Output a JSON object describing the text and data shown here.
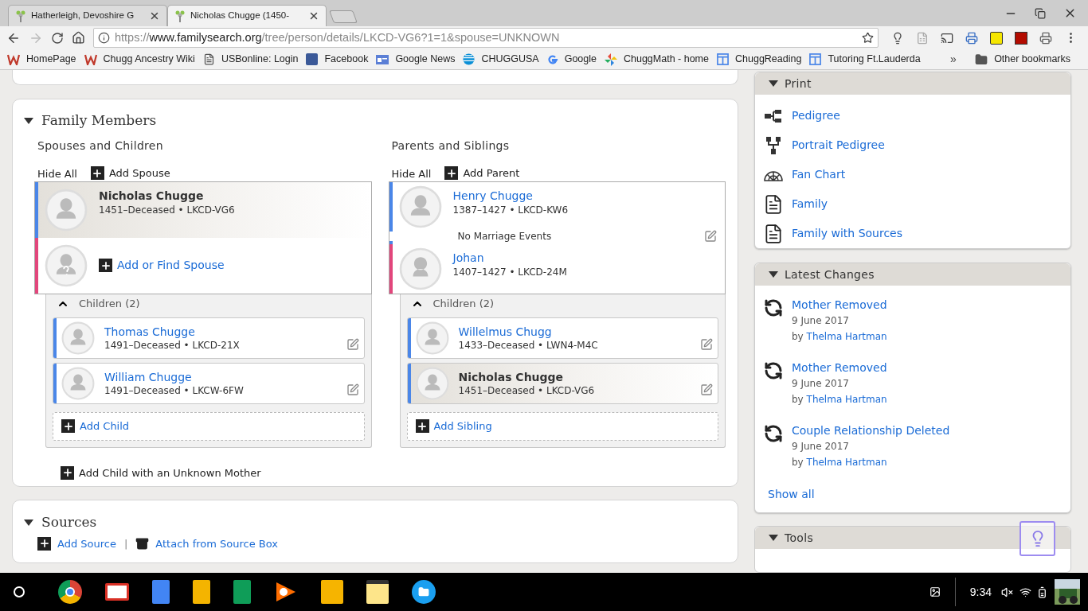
{
  "browser": {
    "tabs": [
      {
        "title": "Hatherleigh, Devoshire G",
        "selected": false
      },
      {
        "title": "Nicholas Chugge (1450-",
        "selected": true
      }
    ],
    "url": {
      "scheme": "https://",
      "domain": "www.familysearch.org",
      "path": "/tree/person/details/LKCD-VG6?1=1&spouse=UNKNOWN"
    },
    "bookmarks": [
      {
        "label": "HomePage",
        "kind": "wiki"
      },
      {
        "label": "Chugg Ancestry Wiki",
        "kind": "wiki"
      },
      {
        "label": "USBonline: Login",
        "kind": "page"
      },
      {
        "label": "Facebook",
        "kind": "facebook"
      },
      {
        "label": "Google News",
        "kind": "news"
      },
      {
        "label": "CHUGGUSA",
        "kind": "globe"
      },
      {
        "label": "Google",
        "kind": "google"
      },
      {
        "label": "ChuggMath - home",
        "kind": "pinwheel"
      },
      {
        "label": "ChuggReading",
        "kind": "sheet"
      },
      {
        "label": "Tutoring Ft.Lauderda",
        "kind": "sheet"
      }
    ],
    "overflow": "»",
    "other_bookmarks": "Other bookmarks"
  },
  "family_members": {
    "title": "Family Members",
    "expanded": true,
    "spouses": {
      "heading": "Spouses and Children",
      "hide_all": "Hide All",
      "add_label": "Add Spouse",
      "couple": [
        {
          "kind": "male",
          "name": "Nicholas Chugge",
          "details": "1451–Deceased • LKCD-VG6",
          "current": true
        },
        {
          "kind": "unknown",
          "add_label": "Add or Find Spouse"
        }
      ],
      "children_label": "Children (2)",
      "children_expanded": true,
      "children": [
        {
          "kind": "male",
          "name": "Thomas Chugge",
          "details": "1491–Deceased • LKCD-21X",
          "current": false
        },
        {
          "kind": "male",
          "name": "William Chugge",
          "details": "1491–Deceased • LKCW-6FW",
          "current": false
        }
      ],
      "add_child": "Add Child"
    },
    "parents": {
      "heading": "Parents and Siblings",
      "hide_all": "Hide All",
      "add_label": "Add Parent",
      "couple": [
        {
          "kind": "male",
          "name": "Henry Chugge",
          "details": "1387–1427 • LKCD-KW6",
          "current": false
        },
        {
          "kind": "female",
          "name": "Johan",
          "details": "1407–1427 • LKCD-24M",
          "current": false
        }
      ],
      "marriage": "No Marriage Events",
      "children_label": "Children (2)",
      "children_expanded": true,
      "children": [
        {
          "kind": "male",
          "name": "Willelmus Chugg",
          "details": "1433–Deceased • LWN4-M4C",
          "current": false
        },
        {
          "kind": "male",
          "name": "Nicholas Chugge",
          "details": "1451–Deceased • LKCD-VG6",
          "current": true
        }
      ],
      "add_child": "Add Sibling"
    },
    "add_child_unknown_mother": "Add Child with an Unknown Mother"
  },
  "sources": {
    "title": "Sources",
    "expanded": true,
    "add_source": "Add Source",
    "separator": "|",
    "attach": "Attach from Source Box"
  },
  "print": {
    "title": "Print",
    "expanded": true,
    "items": [
      {
        "label": "Pedigree",
        "kind": "pedigree"
      },
      {
        "label": "Portrait Pedigree",
        "kind": "portrait"
      },
      {
        "label": "Fan Chart",
        "kind": "fan"
      },
      {
        "label": "Family",
        "kind": "document"
      },
      {
        "label": "Family with Sources",
        "kind": "document"
      }
    ]
  },
  "latest_changes": {
    "title": "Latest Changes",
    "expanded": true,
    "items": [
      {
        "title": "Mother Removed",
        "date": "9 June 2017",
        "by": "by",
        "author": "Thelma Hartman"
      },
      {
        "title": "Mother Removed",
        "date": "9 June 2017",
        "by": "by",
        "author": "Thelma Hartman"
      },
      {
        "title": "Couple Relationship Deleted",
        "date": "9 June 2017",
        "by": "by",
        "author": "Thelma Hartman"
      }
    ],
    "show_all": "Show all"
  },
  "tools": {
    "title": "Tools",
    "expanded": true
  },
  "taskbar": {
    "time": "9:34"
  }
}
